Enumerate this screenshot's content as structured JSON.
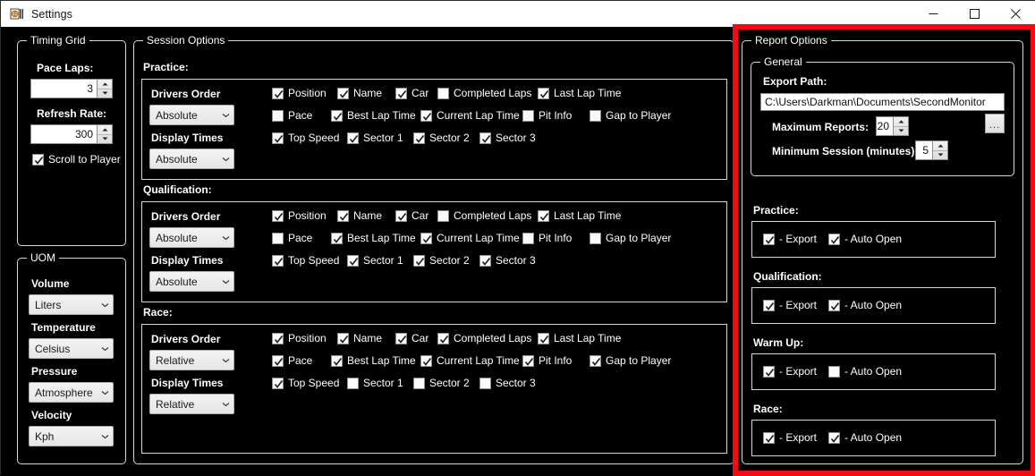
{
  "window": {
    "title": "Settings",
    "app_icon": "settings-app-icon",
    "controls": {
      "minimize": "minimize",
      "maximize": "maximize",
      "close": "close"
    }
  },
  "timing_grid": {
    "title": "Timing Grid",
    "pace_laps_label": "Pace Laps:",
    "pace_laps_value": "3",
    "refresh_rate_label": "Refresh Rate:",
    "refresh_rate_value": "300",
    "scroll_to_player_label": "Scroll to Player",
    "scroll_to_player_checked": true
  },
  "uom": {
    "title": "UOM",
    "fields": [
      {
        "label": "Volume",
        "value": "Liters"
      },
      {
        "label": "Temperature",
        "value": "Celsius"
      },
      {
        "label": "Pressure",
        "value": "Atmosphere"
      },
      {
        "label": "Velocity",
        "value": "Kph"
      }
    ]
  },
  "session_options": {
    "title": "Session Options",
    "drivers_order_label": "Drivers Order",
    "display_times_label": "Display Times",
    "sections": [
      {
        "name": "Practice:",
        "drivers_order": "Absolute",
        "display_times": "Absolute",
        "columns": [
          {
            "label": "Position",
            "checked": true
          },
          {
            "label": "Name",
            "checked": true
          },
          {
            "label": "Car",
            "checked": true
          },
          {
            "label": "Completed Laps",
            "checked": false
          },
          {
            "label": "Last Lap Time",
            "checked": true
          },
          {
            "label": "Pace",
            "checked": false
          },
          {
            "label": "Best Lap Time",
            "checked": true
          },
          {
            "label": "Current Lap Time",
            "checked": true
          },
          {
            "label": "Pit Info",
            "checked": false
          },
          {
            "label": "Gap to Player",
            "checked": false
          },
          {
            "label": "Top Speed",
            "checked": true
          },
          {
            "label": "Sector 1",
            "checked": true
          },
          {
            "label": "Sector 2",
            "checked": true
          },
          {
            "label": "Sector 3",
            "checked": true
          }
        ]
      },
      {
        "name": "Qualification:",
        "drivers_order": "Absolute",
        "display_times": "Absolute",
        "columns": [
          {
            "label": "Position",
            "checked": true
          },
          {
            "label": "Name",
            "checked": true
          },
          {
            "label": "Car",
            "checked": true
          },
          {
            "label": "Completed Laps",
            "checked": false
          },
          {
            "label": "Last Lap Time",
            "checked": true
          },
          {
            "label": "Pace",
            "checked": false
          },
          {
            "label": "Best Lap Time",
            "checked": true
          },
          {
            "label": "Current Lap Time",
            "checked": true
          },
          {
            "label": "Pit Info",
            "checked": false
          },
          {
            "label": "Gap to Player",
            "checked": false
          },
          {
            "label": "Top Speed",
            "checked": true
          },
          {
            "label": "Sector 1",
            "checked": true
          },
          {
            "label": "Sector 2",
            "checked": true
          },
          {
            "label": "Sector 3",
            "checked": true
          }
        ]
      },
      {
        "name": "Race:",
        "drivers_order": "Relative",
        "display_times": "Relative",
        "columns": [
          {
            "label": "Position",
            "checked": true
          },
          {
            "label": "Name",
            "checked": true
          },
          {
            "label": "Car",
            "checked": true
          },
          {
            "label": "Completed Laps",
            "checked": true
          },
          {
            "label": "Last Lap Time",
            "checked": true
          },
          {
            "label": "Pace",
            "checked": true
          },
          {
            "label": "Best Lap Time",
            "checked": true
          },
          {
            "label": "Current Lap Time",
            "checked": true
          },
          {
            "label": "Pit Info",
            "checked": true
          },
          {
            "label": "Gap to Player",
            "checked": true
          },
          {
            "label": "Top Speed",
            "checked": true
          },
          {
            "label": "Sector 1",
            "checked": false
          },
          {
            "label": "Sector 2",
            "checked": false
          },
          {
            "label": "Sector 3",
            "checked": false
          }
        ]
      }
    ]
  },
  "report_options": {
    "title": "Report Options",
    "highlight_color": "#f30b14",
    "general": {
      "title": "General",
      "export_path_label": "Export Path:",
      "export_path_value": "C:\\Users\\Darkman\\Documents\\SecondMonitor",
      "browse_label": "...",
      "maximum_reports_label": "Maximum Reports:",
      "maximum_reports_value": "20",
      "minimum_session_label": "Minimum Session (minutes):",
      "minimum_session_value": "5"
    },
    "sessions": [
      {
        "name": "Practice:",
        "export_label": "- Export",
        "export_checked": true,
        "auto_open_label": "- Auto Open",
        "auto_open_checked": true
      },
      {
        "name": "Qualification:",
        "export_label": "- Export",
        "export_checked": true,
        "auto_open_label": "- Auto Open",
        "auto_open_checked": true
      },
      {
        "name": "Warm Up:",
        "export_label": "- Export",
        "export_checked": true,
        "auto_open_label": "- Auto Open",
        "auto_open_checked": false
      },
      {
        "name": "Race:",
        "export_label": "- Export",
        "export_checked": true,
        "auto_open_label": "- Auto Open",
        "auto_open_checked": true
      }
    ]
  }
}
